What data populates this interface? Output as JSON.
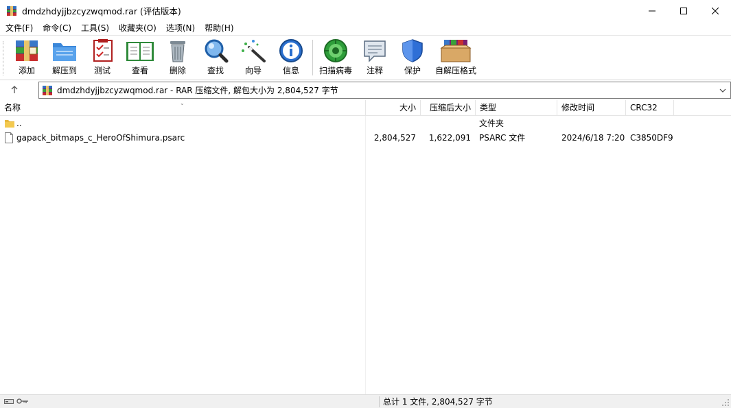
{
  "window": {
    "title": "dmdzhdyjjbzcyzwqmod.rar (评估版本)",
    "minimize_icon": "minimize-icon",
    "maximize_icon": "maximize-icon",
    "close_icon": "close-icon"
  },
  "menu": [
    "文件(F)",
    "命令(C)",
    "工具(S)",
    "收藏夹(O)",
    "选项(N)",
    "帮助(H)"
  ],
  "toolbar": {
    "add": "添加",
    "extract": "解压到",
    "test": "测试",
    "view": "查看",
    "delete": "删除",
    "find": "查找",
    "wizard": "向导",
    "info": "信息",
    "scan": "扫描病毒",
    "comment": "注释",
    "protect": "保护",
    "sfx": "自解压格式"
  },
  "address": {
    "text": "dmdzhdyjjbzcyzwqmod.rar - RAR 压缩文件, 解包大小为 2,804,527 字节"
  },
  "columns": {
    "name": "名称",
    "size": "大小",
    "packed": "压缩后大小",
    "type": "类型",
    "modified": "修改时间",
    "crc": "CRC32"
  },
  "rows": [
    {
      "name": "..",
      "size": "",
      "packed": "",
      "type": "文件夹",
      "modified": "",
      "crc": "",
      "icon": "folder-icon"
    },
    {
      "name": "gapack_bitmaps_c_HeroOfShimura.psarc",
      "size": "2,804,527",
      "packed": "1,622,091",
      "type": "PSARC 文件",
      "modified": "2024/6/18 7:20",
      "crc": "C3850DF9",
      "icon": "file-icon"
    }
  ],
  "status": {
    "text": "总计 1 文件, 2,804,527 字节"
  },
  "colors": {
    "folder": "#f3c94f",
    "accent_blue": "#1e6fd6",
    "border": "#7a7a7a"
  }
}
